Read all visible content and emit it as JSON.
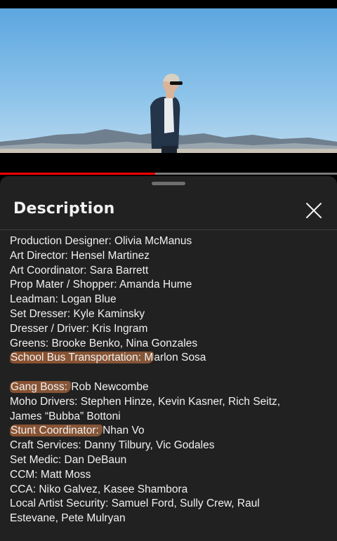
{
  "video": {
    "progress_fraction": 0.46,
    "progress_color": "#ff0000"
  },
  "panel": {
    "title": "Description",
    "close_icon": "close-x-icon"
  },
  "description_lines": [
    {
      "text": "Production Designer: Olivia McManus"
    },
    {
      "text": "Art Director: Hensel Martinez"
    },
    {
      "text": "Art Coordinator: Sara Barrett"
    },
    {
      "text": "Prop Mater / Shopper: Amanda Hume"
    },
    {
      "text": "Leadman: Logan Blue"
    },
    {
      "text": "Set Dresser: Kyle Kaminsky"
    },
    {
      "text": "Dresser / Driver: Kris Ingram"
    },
    {
      "text": "Greens: Brooke Benko, Nina Gonzales"
    },
    {
      "highlight": "School Bus Transportation: M",
      "text": "arlon Sosa"
    },
    {
      "text": ""
    },
    {
      "highlight": "Gang Boss: ",
      "text": "Rob Newcombe"
    },
    {
      "text": "Moho Drivers: Stephen Hinze, Kevin Kasner, Rich Seitz,"
    },
    {
      "text": "James “Bubba” Bottoni"
    },
    {
      "highlight": "Stunt Coordinator: ",
      "text": "Nhan Vo"
    },
    {
      "text": "Craft Services: Danny Tilbury, Vic Godales"
    },
    {
      "text": "Set Medic: Dan DeBaun"
    },
    {
      "text": "CCM: Matt Moss"
    },
    {
      "text": "CCA: Niko Galvez, Kasee Shambora"
    },
    {
      "text": "Local Artist Security: Samuel Ford, Sully Crew, Raul"
    },
    {
      "text": "Estevane, Pete Mulryan"
    }
  ]
}
